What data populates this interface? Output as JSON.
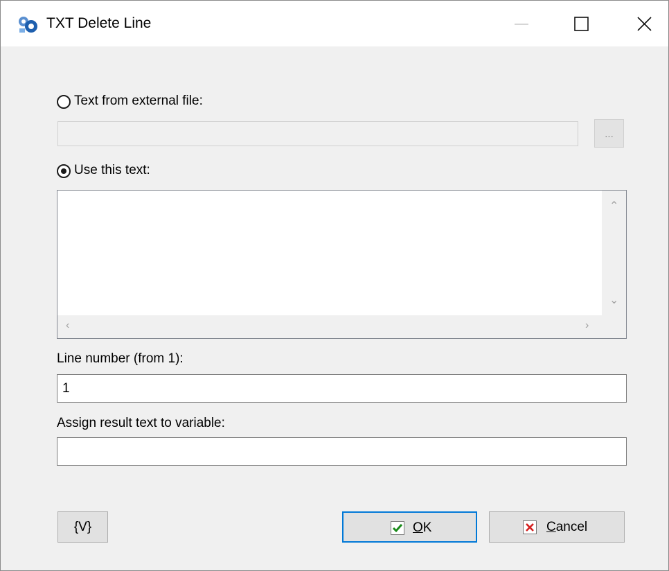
{
  "window": {
    "title": "TXT Delete Line"
  },
  "source": {
    "external_file_label": "Text from external file:",
    "external_file_selected": false,
    "external_file_value": "",
    "browse_label": "...",
    "use_text_label": "Use this text:",
    "use_text_selected": true,
    "text_value": ""
  },
  "line_number": {
    "label": "Line number (from 1):",
    "value": "1"
  },
  "assign": {
    "label": "Assign result text  to variable:",
    "value": ""
  },
  "buttons": {
    "variables_label": "{V}",
    "ok_mnemonic": "O",
    "ok_rest": "K",
    "cancel_mnemonic": "C",
    "cancel_rest": "ancel"
  },
  "icons": {
    "app": "gears-icon",
    "ok": "check-icon",
    "cancel": "x-icon"
  },
  "colors": {
    "ok_border": "#0078d7",
    "check_green": "#1a8a1a",
    "cancel_red": "#d42020"
  }
}
